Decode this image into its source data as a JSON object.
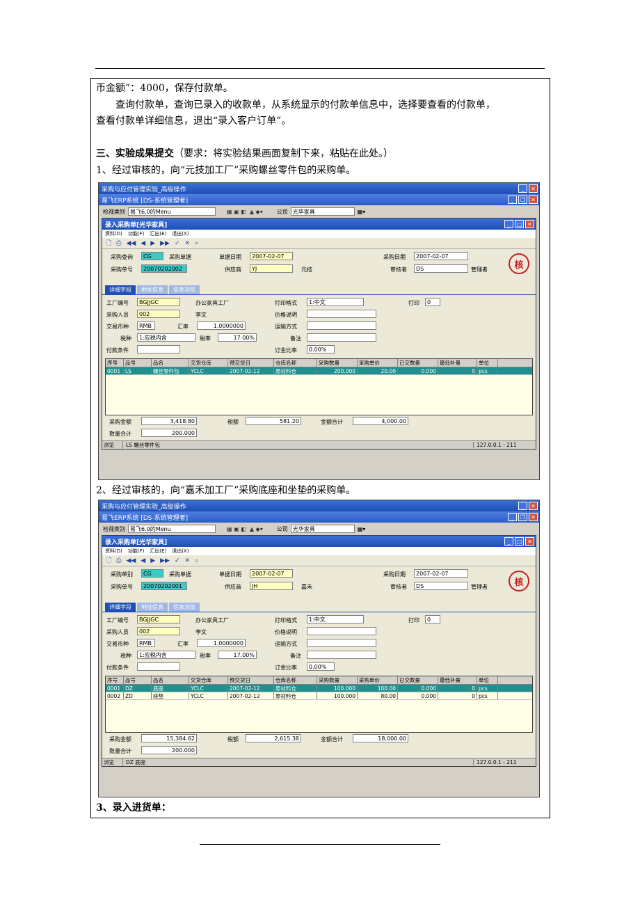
{
  "text": {
    "line1": "币金额”：4000，保存付款单。",
    "line2": "查询付款单，查询已录入的收款单，从系统显示的付款单信息中，选择要查看的付款单，",
    "line3": "查看付款单详细信息，退出“录入客户订单”。",
    "section_title": "三、实验成果提交",
    "section_note": "（要求：将实验结果画面复制下来，粘贴在此处。）",
    "item1": "1、经过审核的，向“元技加工厂”采购螺丝零件包的采购单。",
    "item2": "2、经过审核的，向“嘉禾加工厂”采购底座和坐垫的采购单。",
    "item3": "3、录入进货单："
  },
  "windows": [
    {
      "title_outer": "采购与应付管理实验_高级操作",
      "title_erp": "易飞ERP系统 [DS-系统管理者]",
      "view_label": "检视类别",
      "view_value": "易飞6.0的Menu",
      "company_label": "公司",
      "company_value": "光华家具",
      "child_title": "录入采购单[光华家具]",
      "menu": [
        "资料(D)",
        "功能(F)",
        "汇出(E)",
        "退出(X)"
      ],
      "f_query_label": "采购查询",
      "f_type": "CG",
      "f_doc_label": "采购单据",
      "f_date_label": "单据日期",
      "f_date": "2007-02-07",
      "f_pdate_label": "采购日期",
      "f_pdate": "2007-02-07",
      "f_no_label": "采购单号",
      "f_no": "20070202002",
      "f_supplier_label": "供应商",
      "f_supplier": "YJ",
      "f_supplier_name": "元技",
      "f_auditor_label": "审核者",
      "f_auditor": "DS",
      "f_auditor_name": "管理者",
      "tabs": [
        "详细字段",
        "地址信息",
        "信息浏览"
      ],
      "factory_label": "工厂编号",
      "factory": "BGJJGC",
      "factory_name": "办公家具工厂",
      "buyer_label": "采购人员",
      "buyer": "002",
      "buyer_name": "李文",
      "currency_label": "交易币种",
      "currency": "RMB",
      "rate_label": "汇率",
      "rate": "1.0000000",
      "taxtype_label": "税种",
      "taxtype": "1:应税内含",
      "taxrate_label": "税率",
      "taxrate": "17.00%",
      "payterm_label": "付款条件",
      "printfmt_label": "打印格式",
      "printfmt": "1:中文",
      "print_label": "打印",
      "print": "0",
      "price_label": "价格说明",
      "ship_label": "运输方式",
      "remark_label": "备注",
      "deposit_label": "订金比率",
      "deposit": "0.00%",
      "grid_headers": [
        "序号",
        "品号",
        "品名",
        "交货仓库",
        "预交货日",
        "仓库名称",
        "采购数量",
        "采购单价",
        "已交数量",
        "最低补量",
        "单位"
      ],
      "rows": [
        [
          "0001",
          "LS",
          "螺丝零件包",
          "YCLC",
          "2007-02-12",
          "原材料仓",
          "200.000",
          "20.00",
          "0.000",
          "0",
          "pcs"
        ]
      ],
      "amount_label": "采购金额",
      "amount": "3,418.80",
      "tax_label": "税额",
      "tax": "581.20",
      "total_label": "金额合计",
      "total": "4,000.00",
      "qty_label": "数量合计",
      "qty": "200.000",
      "status_left": "浏览",
      "status_mid": "LS 螺丝零件包",
      "status_right": "127.0.0.1 - 211"
    },
    {
      "title_outer": "采购与应付管理实验_高级操作",
      "title_erp": "易飞ERP系统 [DS-系统管理者]",
      "view_label": "检视类别",
      "view_value": "易飞6.0的Menu",
      "company_label": "公司",
      "company_value": "光华家具",
      "child_title": "录入采购单[光华家具]",
      "menu": [
        "资料(D)",
        "功能(F)",
        "汇出(E)",
        "退出(X)"
      ],
      "f_query_label": "采购单别",
      "f_type": "CG",
      "f_doc_label": "采购单据",
      "f_date_label": "单据日期",
      "f_date": "2007-02-07",
      "f_pdate_label": "采购日期",
      "f_pdate": "2007-02-07",
      "f_no_label": "采购单号",
      "f_no": "20070202001",
      "f_supplier_label": "供应商",
      "f_supplier": "JH",
      "f_supplier_name": "嘉禾",
      "f_auditor_label": "审核者",
      "f_auditor": "DS",
      "f_auditor_name": "管理者",
      "tabs": [
        "详细字段",
        "地址信息",
        "信息浏览"
      ],
      "factory_label": "工厂编号",
      "factory": "BGJJGC",
      "factory_name": "办公家具工厂",
      "buyer_label": "采购人员",
      "buyer": "002",
      "buyer_name": "李文",
      "currency_label": "交易币种",
      "currency": "RMB",
      "rate_label": "汇率",
      "rate": "1.0000000",
      "taxtype_label": "税种",
      "taxtype": "1:应税内含",
      "taxrate_label": "税率",
      "taxrate": "17.00%",
      "payterm_label": "付款条件",
      "printfmt_label": "打印格式",
      "printfmt": "1:中文",
      "print_label": "打印",
      "print": "0",
      "price_label": "价格说明",
      "ship_label": "运输方式",
      "remark_label": "备注",
      "deposit_label": "订金比率",
      "deposit": "0.00%",
      "grid_headers": [
        "序号",
        "品号",
        "品名",
        "交货仓库",
        "预交货日",
        "仓库名称",
        "采购数量",
        "采购单价",
        "已交数量",
        "最低补量",
        "单位"
      ],
      "rows": [
        [
          "0001",
          "DZ",
          "底座",
          "YCLC",
          "2007-02-12",
          "原材料仓",
          "100.000",
          "100.00",
          "0.000",
          "0",
          "pcs"
        ],
        [
          "0002",
          "ZD",
          "座垫",
          "YCLC",
          "2007-02-12",
          "原材料仓",
          "100.000",
          "80.00",
          "0.000",
          "0",
          "pcs"
        ]
      ],
      "amount_label": "采购金额",
      "amount": "15,384.62",
      "tax_label": "税额",
      "tax": "2,615.38",
      "total_label": "金额合计",
      "total": "18,000.00",
      "qty_label": "数量合计",
      "qty": "200.000",
      "status_left": "浏览",
      "status_mid": "DZ 底座",
      "status_right": "127.0.0.1 - 211"
    }
  ],
  "seal_text": "核"
}
